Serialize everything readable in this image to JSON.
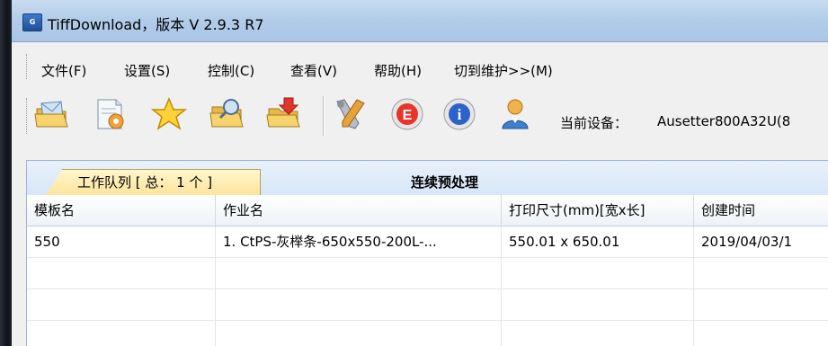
{
  "window": {
    "title": "TiffDownload，版本 V 2.9.3 R7",
    "icon": "app-icon"
  },
  "menu": {
    "items": [
      {
        "label": "文件(F)"
      },
      {
        "label": "设置(S)"
      },
      {
        "label": "控制(C)"
      },
      {
        "label": "查看(V)"
      },
      {
        "label": "帮助(H)"
      },
      {
        "label": "切到维护>>(M)"
      }
    ]
  },
  "toolbar": {
    "buttons": [
      {
        "icon": "open-folder-mail-icon"
      },
      {
        "icon": "document-settings-icon"
      },
      {
        "icon": "favorite-star-icon"
      },
      {
        "icon": "folder-search-icon"
      },
      {
        "icon": "folder-download-icon"
      },
      {
        "icon": "tools-icon"
      },
      {
        "icon": "e-circle-icon"
      },
      {
        "icon": "info-icon"
      },
      {
        "icon": "user-icon"
      }
    ],
    "device_label": "当前设备：",
    "device_value": "Ausetter800A32U(8"
  },
  "tabs": [
    {
      "label": "工作队列 [ 总： 1 个 ]",
      "active": true
    },
    {
      "label": "连续预处理",
      "active": false
    }
  ],
  "table": {
    "columns": [
      "模板名",
      "作业名",
      "打印尺寸(mm)[宽x长]",
      "创建时间"
    ],
    "rows": [
      [
        "550",
        "1. CtPS-灰榉条-650x550-200L-...",
        "550.01 x 650.01",
        "2019/04/03/1"
      ]
    ]
  },
  "colors": {
    "titlebar": "#b3cde9",
    "tab_active": "#ffe49a",
    "tabstrip": "#d7e6f7"
  }
}
